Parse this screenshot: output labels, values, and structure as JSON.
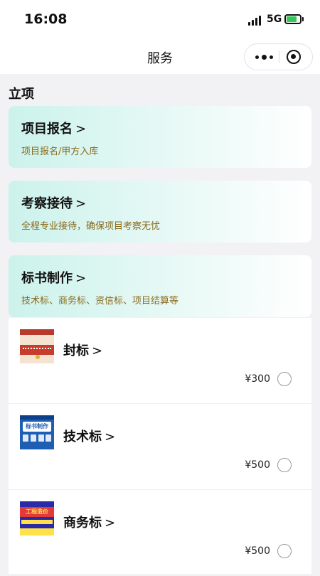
{
  "status_bar": {
    "time": "16:08",
    "network": "5G"
  },
  "navbar": {
    "title": "服务"
  },
  "section": {
    "title": "立项"
  },
  "cards": [
    {
      "title": "项目报名",
      "subtitle": "项目报名/甲方入库"
    },
    {
      "title": "考察接待",
      "subtitle": "全程专业接待，确保项目考察无忧"
    },
    {
      "title": "标书制作",
      "subtitle": "技术标、商务标、资信标、项目结算等"
    }
  ],
  "chevron": ">",
  "items": [
    {
      "name": "封标",
      "price": "¥300",
      "thumb_icon": "sealed-envelope-thumbnail"
    },
    {
      "name": "技术标",
      "price": "¥500",
      "thumb_icon": "bid-document-thumbnail",
      "thumb_text": "标书制作"
    },
    {
      "name": "商务标",
      "price": "¥500",
      "thumb_icon": "cost-estimate-thumbnail",
      "thumb_text": "工程造价"
    }
  ],
  "colors": {
    "accent_card_gradient_start": "#ccf2ec",
    "subtitle_color": "#8a6a1a",
    "battery_green": "#34c759"
  }
}
